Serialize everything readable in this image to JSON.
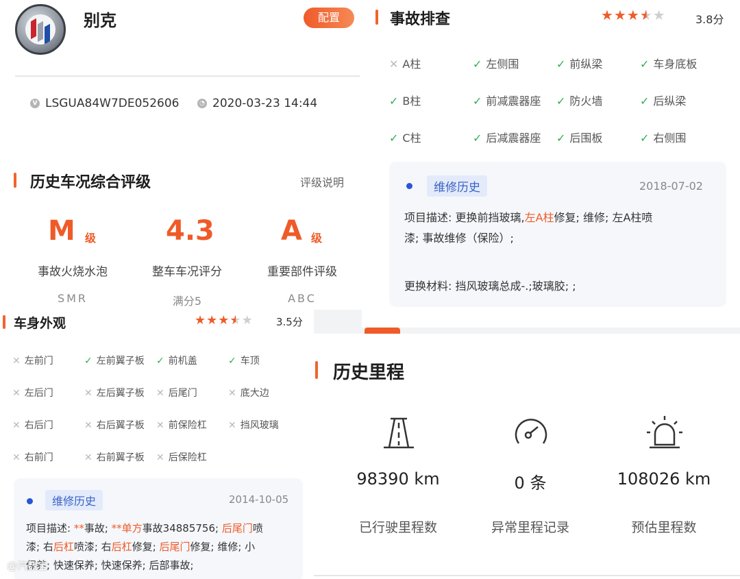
{
  "brand": {
    "name": "别克",
    "config_label": "配置",
    "vin": "LSGUA84W7DE052606",
    "datetime": "2020-03-23 14:44",
    "vin_icon": "v-badge-icon",
    "time_icon": "clock-icon"
  },
  "rating": {
    "title": "历史车况综合评级",
    "help_label": "评级说明",
    "grades": [
      {
        "value": "M",
        "unit": "级",
        "label": "事故火烧水泡",
        "sub": "SMR"
      },
      {
        "value": "4.3",
        "unit": "",
        "label": "整车车况评分",
        "sub": "满分5"
      },
      {
        "value": "A",
        "unit": "级",
        "label": "重要部件评级",
        "sub": "ABC"
      }
    ]
  },
  "body_appearance": {
    "title": "车身外观",
    "rating": 3.5,
    "score_text": "3.5分",
    "items": [
      {
        "label": "左前门",
        "ok": false
      },
      {
        "label": "左前翼子板",
        "ok": true
      },
      {
        "label": "前机盖",
        "ok": true
      },
      {
        "label": "车顶",
        "ok": true
      },
      {
        "label": "左后门",
        "ok": false
      },
      {
        "label": "左后翼子板",
        "ok": false
      },
      {
        "label": "后尾门",
        "ok": false
      },
      {
        "label": "底大边",
        "ok": false
      },
      {
        "label": "右后门",
        "ok": false
      },
      {
        "label": "右后翼子板",
        "ok": false
      },
      {
        "label": "前保险杠",
        "ok": false
      },
      {
        "label": "挡风玻璃",
        "ok": false
      },
      {
        "label": "右前门",
        "ok": false
      },
      {
        "label": "右前翼子板",
        "ok": false
      },
      {
        "label": "后保险杠",
        "ok": false
      }
    ],
    "history": {
      "tag": "维修历史",
      "date": "2014-10-05",
      "line1_parts": [
        {
          "t": "项目描述: ",
          "h": false
        },
        {
          "t": "**",
          "h": true
        },
        {
          "t": "事故; ",
          "h": false
        },
        {
          "t": "**单方",
          "h": true
        },
        {
          "t": "事故34885756; ",
          "h": false
        },
        {
          "t": "后尾门",
          "h": true
        },
        {
          "t": "喷",
          "h": false
        }
      ],
      "line2_parts": [
        {
          "t": "漆; 右",
          "h": false
        },
        {
          "t": "后杠",
          "h": true
        },
        {
          "t": "喷漆; 右",
          "h": false
        },
        {
          "t": "后杠",
          "h": true
        },
        {
          "t": "修复; ",
          "h": false
        },
        {
          "t": "后尾门",
          "h": true
        },
        {
          "t": "修复; 维修; 小",
          "h": false
        }
      ],
      "line3": "保养; 快速保养; 快速保养; 后部事故;"
    }
  },
  "accident": {
    "title": "事故排查",
    "rating": 3.8,
    "score_text": "3.8分",
    "items": [
      {
        "label": "A柱",
        "ok": false
      },
      {
        "label": "左侧围",
        "ok": true
      },
      {
        "label": "前纵梁",
        "ok": true
      },
      {
        "label": "车身底板",
        "ok": true
      },
      {
        "label": "B柱",
        "ok": true
      },
      {
        "label": "前减震器座",
        "ok": true
      },
      {
        "label": "防火墙",
        "ok": true
      },
      {
        "label": "后纵梁",
        "ok": true
      },
      {
        "label": "C柱",
        "ok": true
      },
      {
        "label": "后减震器座",
        "ok": true
      },
      {
        "label": "后围板",
        "ok": true
      },
      {
        "label": "右侧围",
        "ok": true
      }
    ],
    "history": {
      "tag": "维修历史",
      "date": "2018-07-02",
      "line1_parts": [
        {
          "t": "项目描述: 更换前挡玻璃,",
          "h": false
        },
        {
          "t": "左A柱",
          "h": true
        },
        {
          "t": "修复; 维修; 左A柱喷",
          "h": false
        }
      ],
      "line2": "漆; 事故维修（保险）;",
      "line3": "更换材料: 挡风玻璃总成-.;玻璃胶; ;"
    }
  },
  "mileage": {
    "title": "历史里程",
    "stats": [
      {
        "icon": "road-icon",
        "value": "98390 km",
        "label": "已行驶里程数"
      },
      {
        "icon": "gauge-icon",
        "value": "0 条",
        "label": "异常里程记录"
      },
      {
        "icon": "alarm-light-icon",
        "value": "108026 km",
        "label": "预估里程数"
      }
    ]
  },
  "watermark": "@汽数宝"
}
